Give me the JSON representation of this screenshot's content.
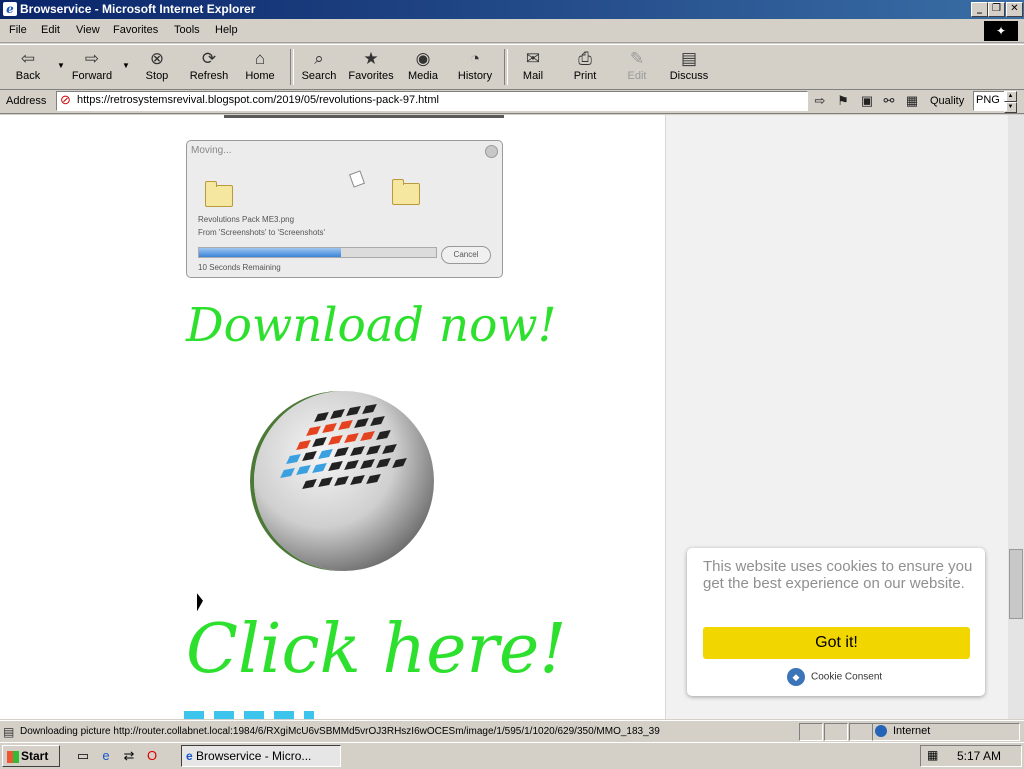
{
  "window": {
    "title": "Browservice - Microsoft Internet Explorer",
    "minimize_label": "_",
    "restore_label": "❐",
    "close_label": "✕"
  },
  "menu": {
    "items": [
      "File",
      "Edit",
      "View",
      "Favorites",
      "Tools",
      "Help"
    ]
  },
  "toolbar": {
    "back": "Back",
    "forward": "Forward",
    "stop": "Stop",
    "refresh": "Refresh",
    "home": "Home",
    "search": "Search",
    "favorites": "Favorites",
    "media": "Media",
    "history": "History",
    "mail": "Mail",
    "print": "Print",
    "edit": "Edit",
    "discuss": "Discuss"
  },
  "address": {
    "label": "Address",
    "url": "https://retrosystemsrevival.blogspot.com/2019/05/revolutions-pack-97.html",
    "quality_label": "Quality",
    "quality_value": "PNG"
  },
  "page": {
    "dialog": {
      "title": "Moving...",
      "filename": "Revolutions Pack ME3.png",
      "from_to": "From 'Screenshots' to 'Screenshots'",
      "remaining": "10 Seconds Remaining",
      "cancel": "Cancel",
      "progress": 0.6
    },
    "download_text": "Download now!",
    "click_text": "Click here!"
  },
  "cookie": {
    "message": "This website uses cookies to ensure you get the best experience on our website.",
    "button": "Got it!",
    "brand": "Cookie Consent"
  },
  "status": {
    "text": "Downloading picture http://router.collabnet.local:1984/6/RXgiMcU6vSBMMd5vrOJ3RHszI6wOCESm/image/1/595/1/1020/629/350/MMO_183_39",
    "zone": "Internet"
  },
  "taskbar": {
    "start": "Start",
    "task": "Browservice - Micro...",
    "clock": "5:17 AM"
  },
  "colors": {
    "accent_green": "#2ee02e",
    "cookie_button": "#f1d600",
    "title_bar": "#0a246a"
  }
}
